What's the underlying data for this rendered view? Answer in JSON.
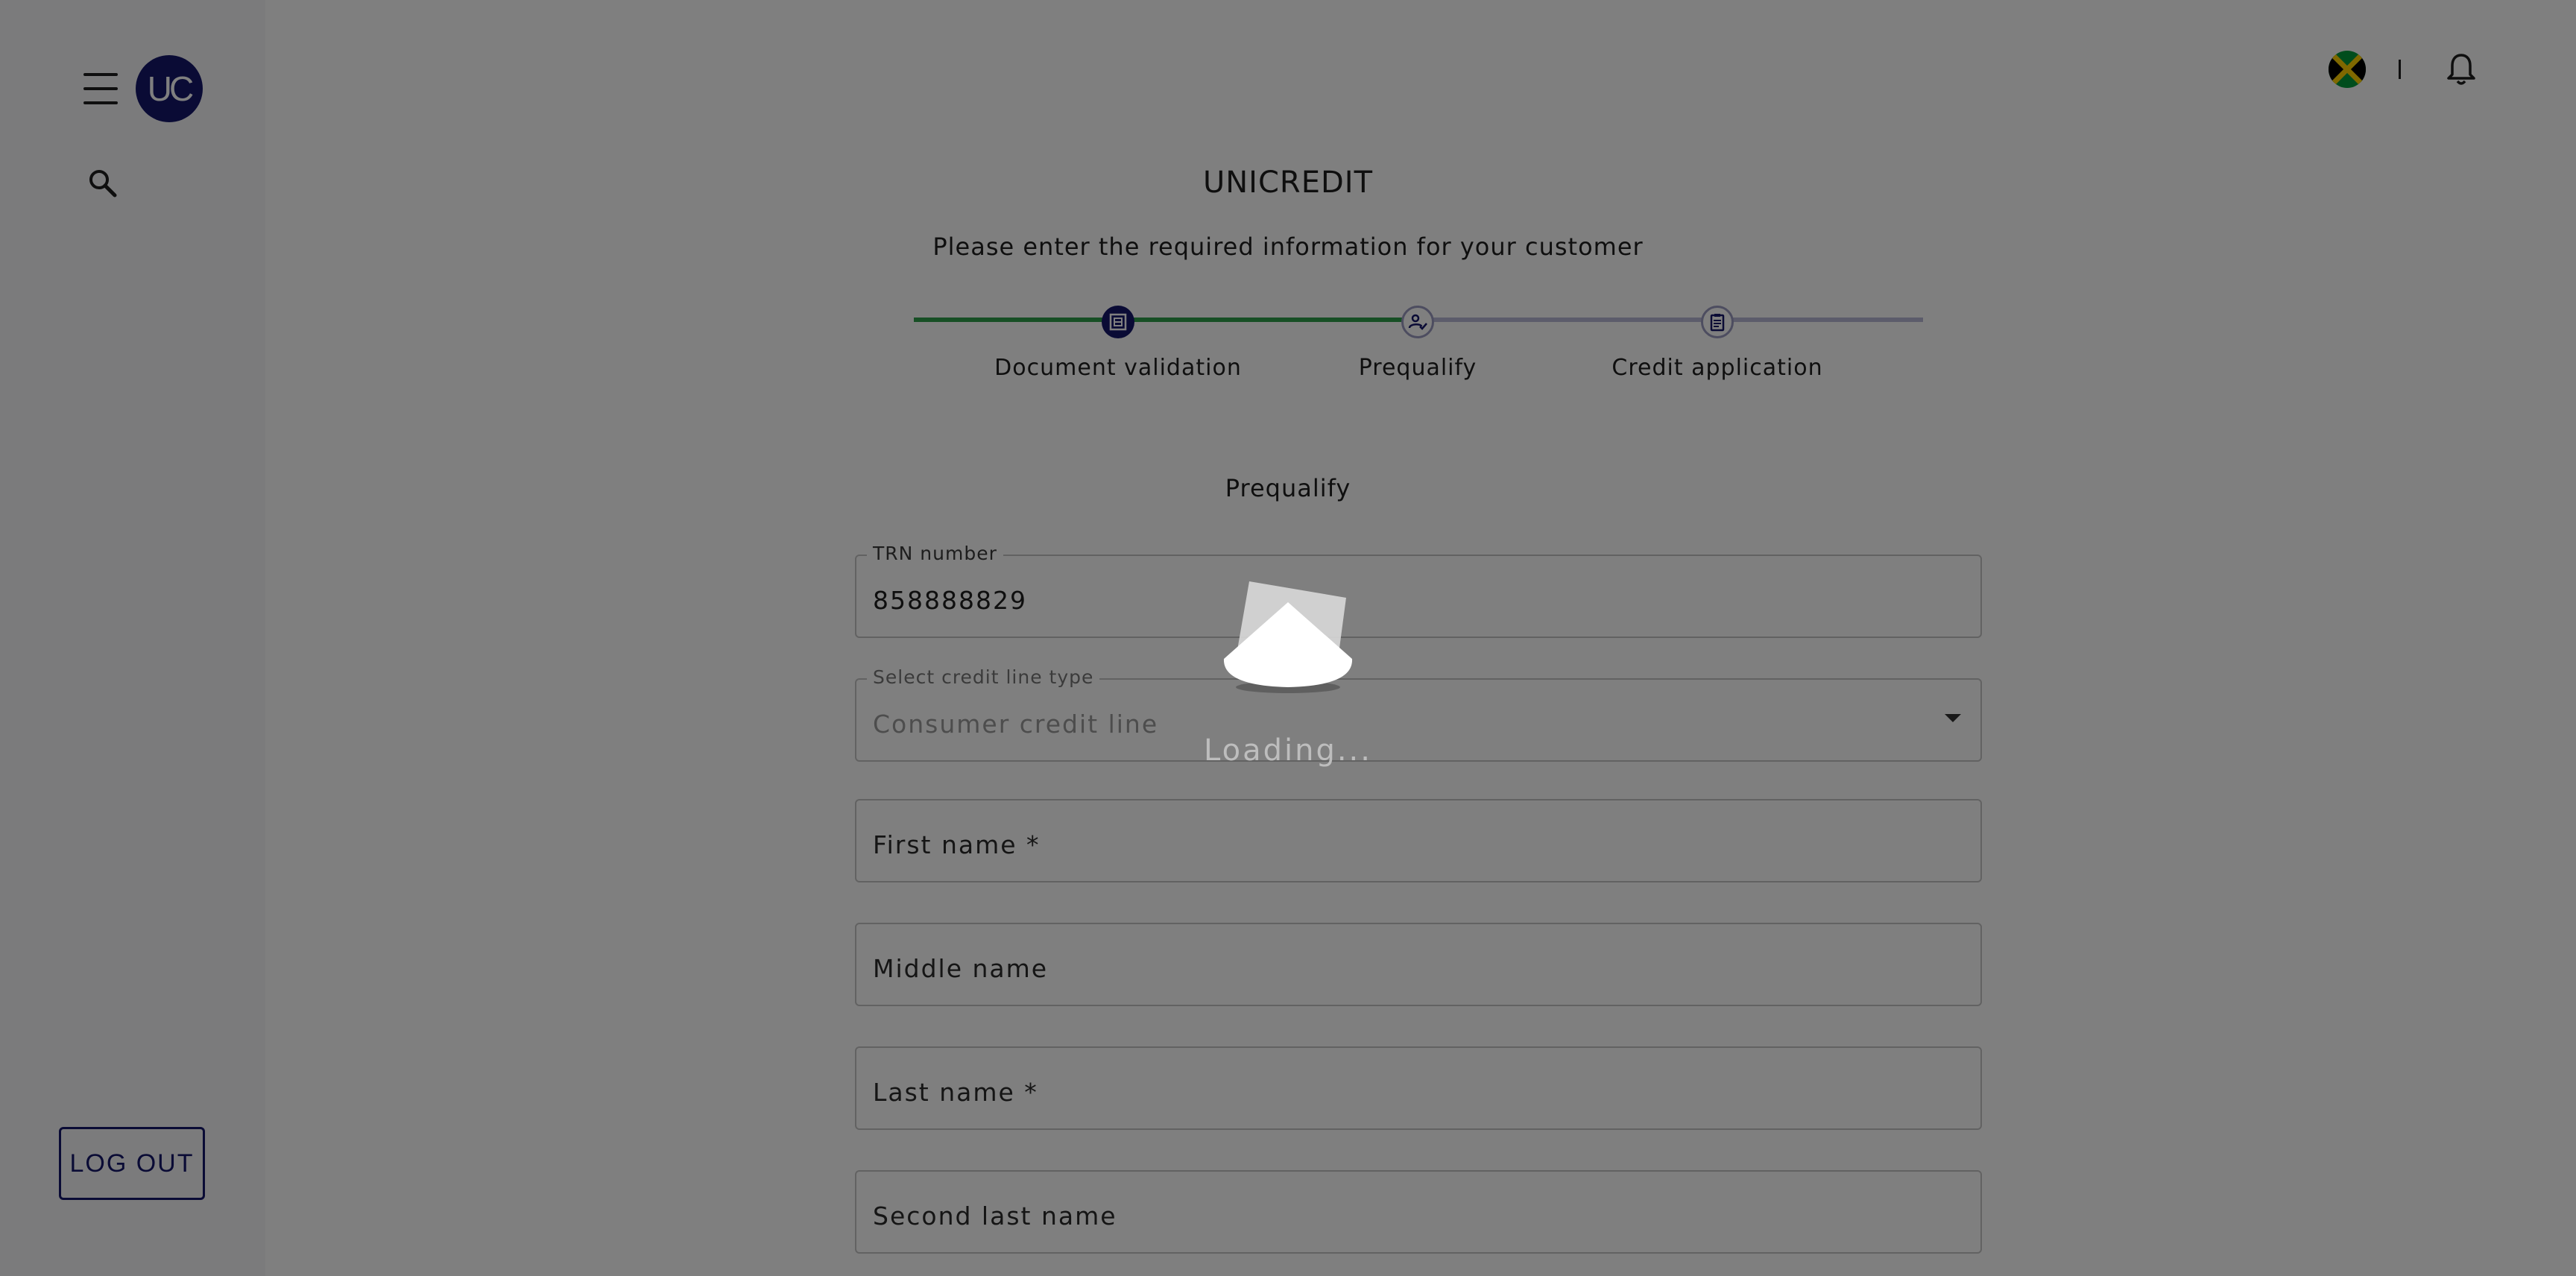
{
  "sidebar": {
    "avatar_text": "UC",
    "logout_label": "LOG OUT"
  },
  "header": {
    "brand": "UNICREDIT",
    "subtitle": "Please enter the required information for your customer"
  },
  "stepper": {
    "steps": [
      {
        "label": "Document validation",
        "state": "completed"
      },
      {
        "label": "Prequalify",
        "state": "active"
      },
      {
        "label": "Credit application",
        "state": "pending"
      }
    ]
  },
  "form": {
    "section_title": "Prequalify",
    "trn": {
      "label": "TRN number",
      "value": "858888829"
    },
    "credit_line": {
      "label": "Select credit line type",
      "value": "Consumer credit line"
    },
    "first_name": {
      "placeholder": "First name *"
    },
    "middle_name": {
      "placeholder": "Middle name"
    },
    "last_name": {
      "placeholder": "Last name *"
    },
    "second_last_name": {
      "placeholder": "Second last name"
    }
  },
  "loading": {
    "text": "Loading..."
  },
  "colors": {
    "brand": "#14176b",
    "progress": "#2e9e4a",
    "pending_line": "#b9b9d6"
  }
}
